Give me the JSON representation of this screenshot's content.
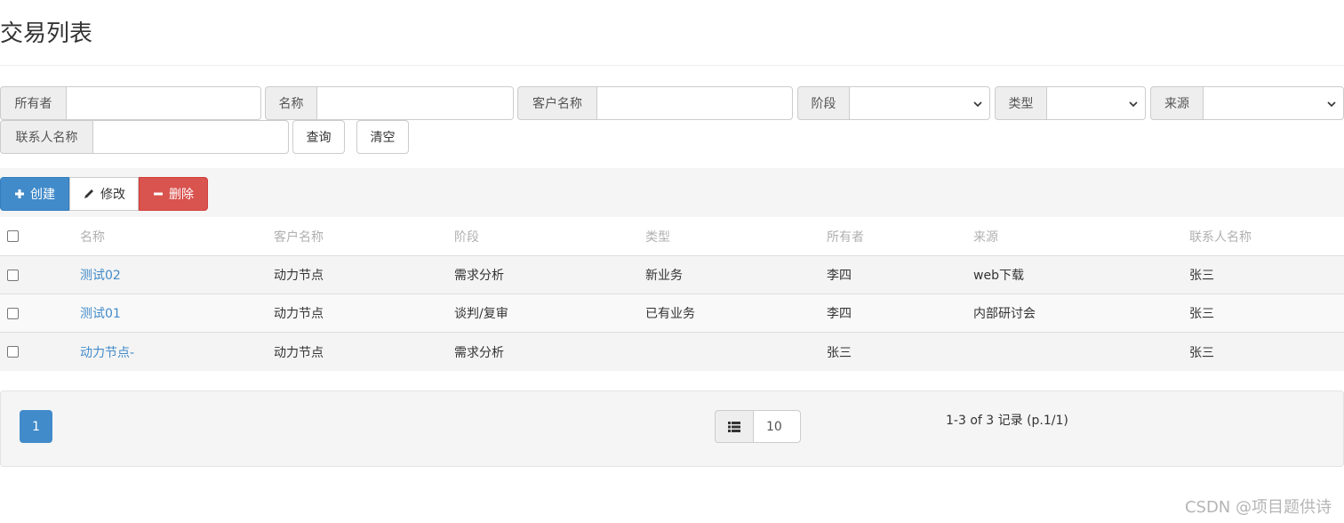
{
  "page": {
    "title": "交易列表"
  },
  "search": {
    "owner_label": "所有者",
    "name_label": "名称",
    "customer_label": "客户名称",
    "stage_label": "阶段",
    "type_label": "类型",
    "source_label": "来源",
    "contact_label": "联系人名称",
    "query_button": "查询",
    "clear_button": "清空"
  },
  "toolbar": {
    "create": "创建",
    "edit": "修改",
    "delete": "删除"
  },
  "table": {
    "headers": [
      "名称",
      "客户名称",
      "阶段",
      "类型",
      "所有者",
      "来源",
      "联系人名称"
    ],
    "rows": [
      {
        "name": "测试02",
        "customer": "动力节点",
        "stage": "需求分析",
        "type": "新业务",
        "owner": "李四",
        "source": "web下载",
        "contact": "张三"
      },
      {
        "name": "测试01",
        "customer": "动力节点",
        "stage": "谈判/复审",
        "type": "已有业务",
        "owner": "李四",
        "source": "内部研讨会",
        "contact": "张三"
      },
      {
        "name": "动力节点-",
        "customer": "动力节点",
        "stage": "需求分析",
        "type": "",
        "owner": "张三",
        "source": "",
        "contact": "张三"
      }
    ]
  },
  "pagination": {
    "current_page": "1",
    "page_size": "10",
    "record_info": "1-3 of 3 记录 (p.1/1)"
  },
  "watermark": "CSDN @项目题供诗",
  "colors": {
    "primary": "#428bca",
    "danger": "#d9534f",
    "band": "#f5f5f5"
  }
}
